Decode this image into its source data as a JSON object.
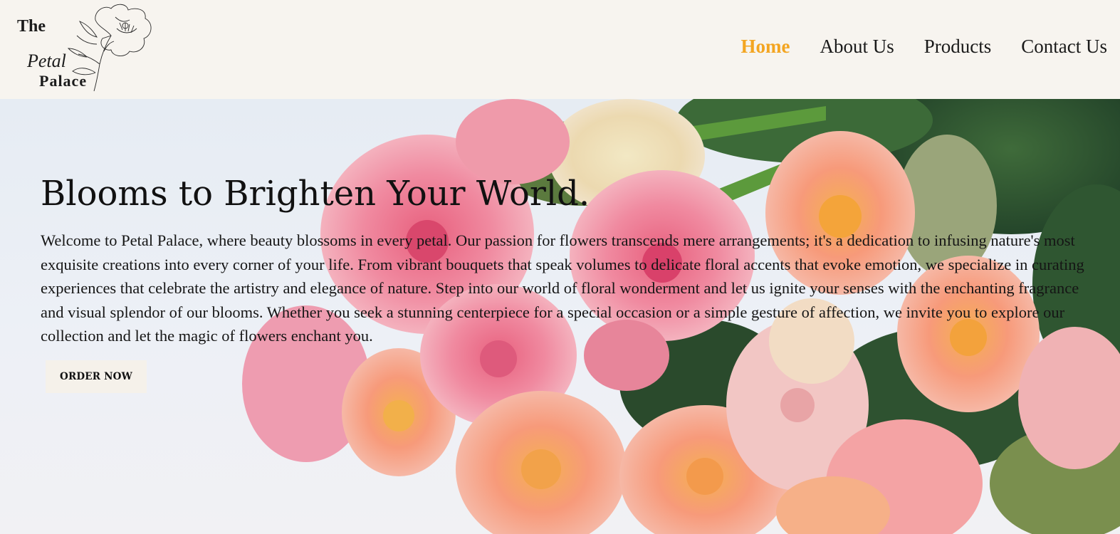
{
  "brand": {
    "logo_lines": [
      "The",
      "Petal",
      "Palace"
    ]
  },
  "nav": {
    "items": [
      {
        "label": "Home",
        "active": true
      },
      {
        "label": "About Us",
        "active": false
      },
      {
        "label": "Products",
        "active": false
      },
      {
        "label": "Contact Us",
        "active": false
      }
    ]
  },
  "hero": {
    "title": "Blooms to Brighten Your World.",
    "body": "Welcome to Petal Palace, where beauty blossoms in every petal. Our passion for flowers transcends mere arrangements; it's a dedication to infusing nature's most exquisite creations into every corner of your life. From vibrant bouquets that speak volumes to delicate floral accents that evoke emotion, we specialize in curating experiences that celebrate the artistry and elegance of nature. Step into our world of floral wonderment and let us ignite your senses with the enchanting fragrance and visual splendor of our blooms. Whether you seek a stunning centerpiece for a special occasion or a simple gesture of affection, we invite you to explore our collection and let the magic of flowers enchant you.",
    "cta_label": "ORDER NOW",
    "background_icon": "rose-bouquet-photo"
  },
  "colors": {
    "accent": "#f3a521",
    "header_bg": "#f7f4ef",
    "text": "#111111"
  }
}
